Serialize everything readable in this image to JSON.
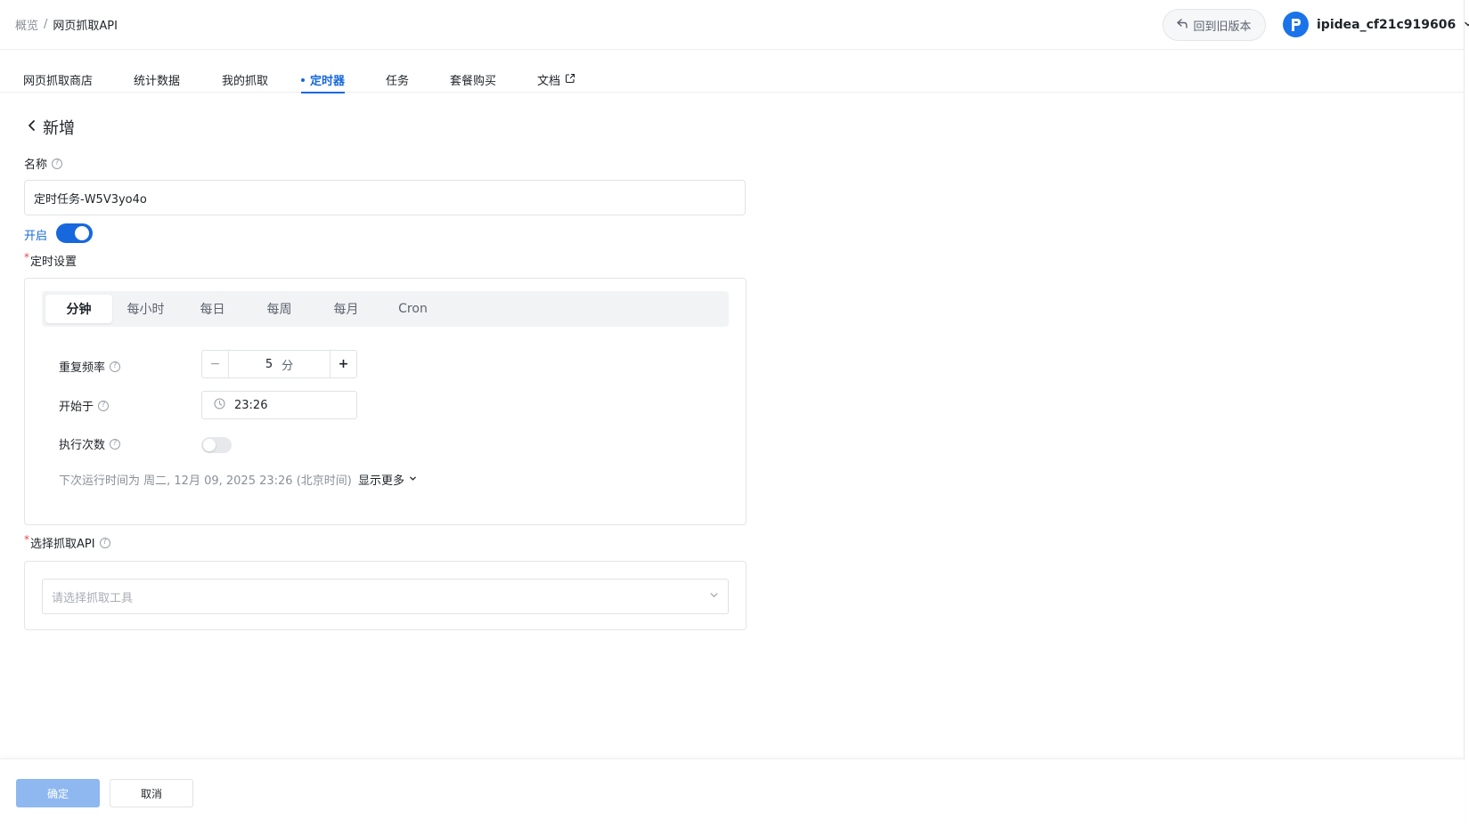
{
  "breadcrumb": {
    "root": "概览",
    "separator": "/",
    "current": "网页抓取API"
  },
  "header": {
    "old_version_label": "回到旧版本",
    "username": "ipidea_cf21c919606"
  },
  "tabs": [
    {
      "label": "网页抓取商店"
    },
    {
      "label": "统计数据"
    },
    {
      "label": "我的抓取"
    },
    {
      "label": "定时器",
      "active": true
    },
    {
      "label": "任务"
    },
    {
      "label": "套餐购买"
    },
    {
      "label": "文档"
    }
  ],
  "page": {
    "title": "新增"
  },
  "form": {
    "name_label": "名称",
    "name_value": "定时任务-W5V3yo4o",
    "enabled_label": "开启",
    "enabled": true,
    "schedule_label": "定时设置",
    "schedule_tabs": [
      "分钟",
      "每小时",
      "每日",
      "每周",
      "每月",
      "Cron"
    ],
    "schedule_active": "分钟",
    "repeat_label": "重复频率",
    "repeat_value": "5",
    "repeat_unit": "分",
    "start_label": "开始于",
    "start_value": "23:26",
    "exec_count_label": "执行次数",
    "exec_count_enabled": false,
    "next_run_text": "下次运行时间为 周二, 12月 09, 2025 23:26 (北京时间)",
    "show_more_label": "显示更多",
    "api_label": "选择抓取API",
    "api_placeholder": "请选择抓取工具"
  },
  "footer": {
    "confirm_label": "确定",
    "cancel_label": "取消"
  },
  "colors": {
    "primary": "#1668dc",
    "confirm_disabled": "#8fb8f0",
    "required": "#e5484d"
  },
  "icons": [
    "back-arrow-icon",
    "chevron-left-icon",
    "help-icon",
    "external-link-icon",
    "clock-icon",
    "chevron-down-icon",
    "logo-icon"
  ]
}
